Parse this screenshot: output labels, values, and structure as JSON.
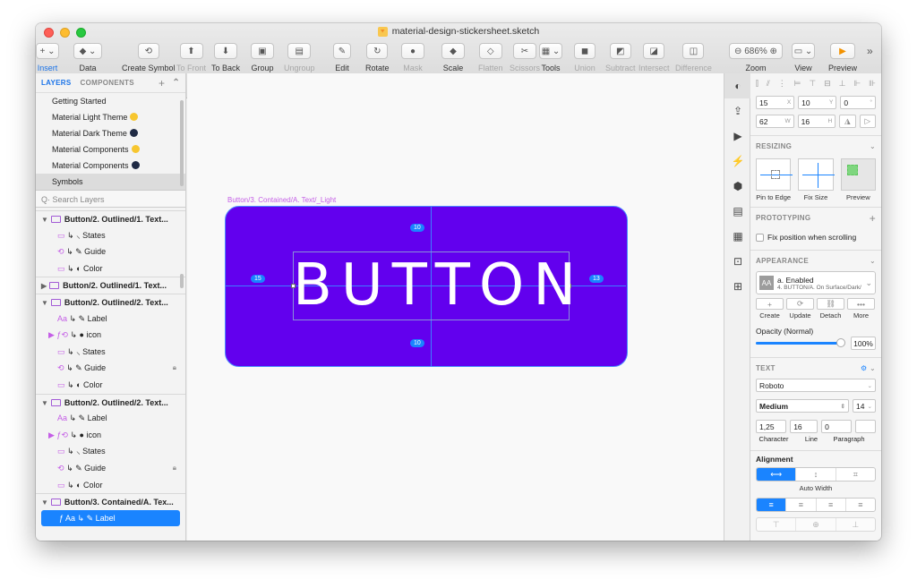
{
  "window": {
    "title": "material-design-stickersheet.sketch"
  },
  "toolbar": {
    "items": [
      {
        "label": "Insert",
        "glyph": "+ ⌄"
      },
      {
        "label": "Data",
        "glyph": "◆ ⌄"
      },
      {
        "label": "Create Symbol",
        "glyph": "⟲"
      },
      {
        "label": "To Front",
        "glyph": "⬆"
      },
      {
        "label": "To Back",
        "glyph": "⬇"
      },
      {
        "label": "Group",
        "glyph": "▣"
      },
      {
        "label": "Ungroup",
        "glyph": "▤"
      },
      {
        "label": "Edit",
        "glyph": "✎"
      },
      {
        "label": "Rotate",
        "glyph": "↻"
      },
      {
        "label": "Mask",
        "glyph": "●"
      },
      {
        "label": "Scale",
        "glyph": "◆"
      },
      {
        "label": "Flatten",
        "glyph": "◇"
      },
      {
        "label": "Scissors",
        "glyph": "✂"
      },
      {
        "label": "Tools",
        "glyph": "▦ ⌄"
      },
      {
        "label": "Union",
        "glyph": "◼"
      },
      {
        "label": "Subtract",
        "glyph": "◩"
      },
      {
        "label": "Intersect",
        "glyph": "◪"
      },
      {
        "label": "Difference",
        "glyph": "◫"
      },
      {
        "label": "Zoom",
        "glyph": "⊖ 686% ⊕"
      },
      {
        "label": "View",
        "glyph": "▭ ⌄"
      },
      {
        "label": "Preview",
        "glyph": "▶"
      }
    ],
    "overflow": "»"
  },
  "layers_panel": {
    "tabs": {
      "layers": "LAYERS",
      "components": "COMPONENTS"
    },
    "pages": [
      {
        "label": "Getting Started",
        "dot": ""
      },
      {
        "label": "Material Light Theme",
        "dot": "#f7c62f"
      },
      {
        "label": "Material Dark Theme",
        "dot": "#1f2a44"
      },
      {
        "label": "Material Components",
        "dot": "#f7c62f"
      },
      {
        "label": "Material Components",
        "dot": "#1f2a44"
      },
      {
        "label": "Symbols",
        "dot": ""
      }
    ],
    "search_placeholder": "Search Layers",
    "layers": [
      {
        "kind": "group",
        "tri": "▼",
        "label": "Button/2. Outlined/1. Text..."
      },
      {
        "kind": "child",
        "icon": "▭",
        "label": "↳ ⸜ States"
      },
      {
        "kind": "child",
        "icon": "⟲",
        "label": "↳ ✎ Guide"
      },
      {
        "kind": "child",
        "icon": "▭",
        "label": "↳ ◐ Color"
      },
      {
        "kind": "group",
        "tri": "▶",
        "label": "Button/2. Outlined/1. Text..."
      },
      {
        "kind": "group",
        "tri": "▼",
        "label": "Button/2. Outlined/2. Text..."
      },
      {
        "kind": "child",
        "icon": "Aa",
        "label": "↳ ✎ Label"
      },
      {
        "kind": "child2",
        "icon": "▶ ƒ⟲",
        "label": "↳ ● icon"
      },
      {
        "kind": "child",
        "icon": "▭",
        "label": "↳ ⸜ States"
      },
      {
        "kind": "child",
        "icon": "⟲",
        "label": "↳ ✎ Guide",
        "lock": true
      },
      {
        "kind": "child",
        "icon": "▭",
        "label": "↳ ◐ Color"
      },
      {
        "kind": "group",
        "tri": "▼",
        "label": "Button/2. Outlined/2. Text..."
      },
      {
        "kind": "child",
        "icon": "Aa",
        "label": "↳ ✎ Label"
      },
      {
        "kind": "child2",
        "icon": "▶ ƒ⟲",
        "label": "↳ ● icon"
      },
      {
        "kind": "child",
        "icon": "▭",
        "label": "↳ ⸜ States"
      },
      {
        "kind": "child",
        "icon": "⟲",
        "label": "↳ ✎ Guide",
        "lock": true
      },
      {
        "kind": "child",
        "icon": "▭",
        "label": "↳ ◐ Color"
      },
      {
        "kind": "group",
        "tri": "▼",
        "label": "Button/3. Contained/A. Tex..."
      },
      {
        "kind": "selected",
        "icon": "ƒ Aa",
        "label": "↳ ✎ Label"
      }
    ]
  },
  "canvas": {
    "artboard_label": "Button/3. Contained/A. Text/_Light",
    "button_text": "BUTTON",
    "button_color": "#6200ee",
    "measure_top": "10",
    "measure_bottom": "10",
    "measure_left": "15",
    "measure_right": "13"
  },
  "inspector": {
    "x": "15",
    "x_unit": "X",
    "y": "10",
    "y_unit": "Y",
    "rotation": "0",
    "rotation_unit": "°",
    "w": "62",
    "w_unit": "W",
    "h": "16",
    "h_unit": "H",
    "resizing_title": "RESIZING",
    "resizing_captions": [
      "Pin to Edge",
      "Fix Size",
      "Preview"
    ],
    "prototyping_title": "PROTOTYPING",
    "fix_position": "Fix position when scrolling",
    "appearance_title": "APPEARANCE",
    "style_badge": "AA",
    "style_name": "a. Enabled",
    "style_path": "4. BUTTON/A. On Surface/Dark/",
    "style_actions": [
      {
        "icon": "+",
        "label": "Create"
      },
      {
        "icon": "⟳",
        "label": "Update"
      },
      {
        "icon": "⛓",
        "label": "Detach"
      },
      {
        "icon": "•••",
        "label": "More"
      }
    ],
    "opacity_label": "Opacity (Normal)",
    "opacity_value": "100%",
    "opacity_level": 1.0,
    "text_title": "TEXT",
    "font_family": "Roboto",
    "font_weight": "Medium",
    "font_size": "14",
    "character": "1,25",
    "line": "16",
    "paragraph": "0",
    "spacing_captions": [
      "Character",
      "Line",
      "Paragraph"
    ],
    "alignment_title": "Alignment",
    "auto_width": "Auto Width",
    "accent": "#1a84ff"
  }
}
